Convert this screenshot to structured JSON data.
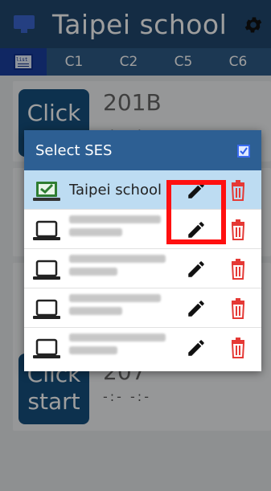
{
  "header": {
    "title": "Taipei school",
    "icons": [
      "monitor-icon",
      "gear-icon"
    ]
  },
  "tabs": [
    {
      "icon": "list-icon",
      "icon_text": "list"
    },
    {
      "label": "C1"
    },
    {
      "label": "C2"
    },
    {
      "label": "C5"
    },
    {
      "label": "C6"
    }
  ],
  "cards": [
    {
      "button": "Click",
      "ses": "201B",
      "times": "-:-   -:-"
    },
    {
      "button": "Click start",
      "ses": "207",
      "times": "-:-   -:-"
    }
  ],
  "dialog": {
    "title": "Select SES",
    "rows": [
      {
        "name": "Taipei school",
        "selected": true
      },
      {
        "name": "",
        "selected": false
      },
      {
        "name": "",
        "selected": false
      },
      {
        "name": "",
        "selected": false
      },
      {
        "name": "",
        "selected": false
      }
    ]
  },
  "colors": {
    "appbar": "#21486e",
    "tabs": "#2e5b86",
    "dialog_header": "#2d5f93",
    "selected_row": "#bddcf2",
    "button": "#16507f",
    "trash": "#e53935",
    "highlight": "#ff1010"
  }
}
